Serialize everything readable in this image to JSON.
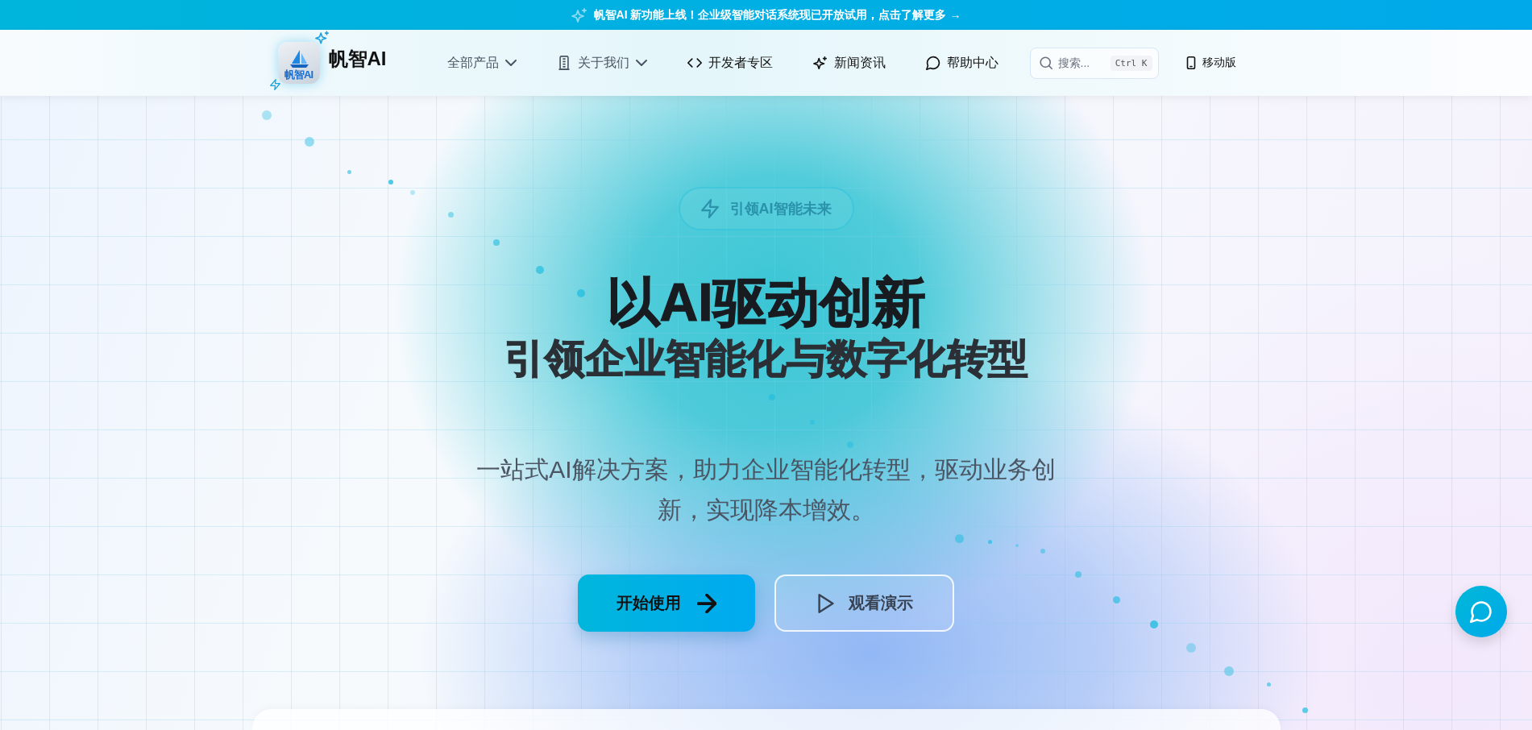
{
  "announcement": {
    "text": "帆智AI 新功能上线！企业级智能对话系统现已开放试用，点击了解更多 →"
  },
  "header": {
    "logo": {
      "badge_text": "帆智AI",
      "name": "帆智AI"
    },
    "nav": [
      {
        "label": "全部产品",
        "has_menu": true
      },
      {
        "label": "关于我们",
        "has_menu": true
      },
      {
        "label": "开发者专区",
        "has_menu": false
      },
      {
        "label": "新闻资讯",
        "has_menu": false
      },
      {
        "label": "帮助中心",
        "has_menu": false
      }
    ],
    "search": {
      "placeholder": "搜索...",
      "shortcut": "Ctrl K"
    },
    "mobile_link": "移动版"
  },
  "hero": {
    "badge": "引领AI智能未来",
    "title_lines": [
      "以AI驱动创新",
      "引领企业智能化与数字化转型"
    ],
    "subtitle": "一站式AI解决方案，助力企业智能化转型，驱动业务创新，实现降本增效。",
    "buttons": [
      {
        "label": "开始使用",
        "kind": "primary"
      },
      {
        "label": "观看演示",
        "kind": "secondary"
      }
    ]
  }
}
